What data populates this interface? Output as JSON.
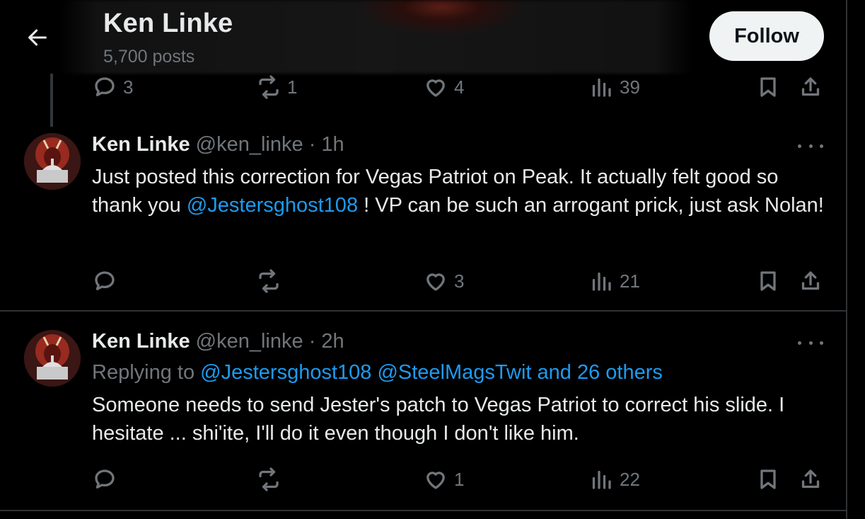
{
  "header": {
    "title": "Ken Linke",
    "posts_count": "5,700 posts",
    "follow_label": "Follow"
  },
  "top_actions": {
    "replies": "3",
    "reposts": "1",
    "likes": "4",
    "views": "39"
  },
  "tweets": [
    {
      "name": "Ken Linke",
      "handle": "@ken_linke",
      "time": "· 1h",
      "text_a": "Just posted this correction for Vegas Patriot on Peak. It actually felt good so thank you ",
      "mention": "@Jestersghost108",
      "text_b": " ! VP can be such an arrogant prick, just ask Nolan!",
      "actions": {
        "replies": "",
        "reposts": "",
        "likes": "3",
        "views": "21"
      }
    },
    {
      "name": "Ken Linke",
      "handle": "@ken_linke",
      "time": "· 2h",
      "replying_label": "Replying to ",
      "replying_to": "@Jestersghost108 @SteelMagsTwit and 26 others",
      "text": "Someone needs to send Jester's patch to Vegas Patriot to correct his slide. I hesitate ... shi'ite, I'll do it even though I don't like him.",
      "actions": {
        "replies": "",
        "reposts": "",
        "likes": "1",
        "views": "22"
      }
    }
  ],
  "colors": {
    "background": "#000000",
    "text": "#e7e9ea",
    "secondary": "#71767b",
    "link": "#1d9bf0",
    "divider": "#2f3336",
    "follow_bg": "#eff3f4"
  },
  "icons": [
    "back-arrow-icon",
    "reply-icon",
    "repost-icon",
    "like-icon",
    "views-icon",
    "bookmark-icon",
    "share-icon",
    "more-icon"
  ]
}
